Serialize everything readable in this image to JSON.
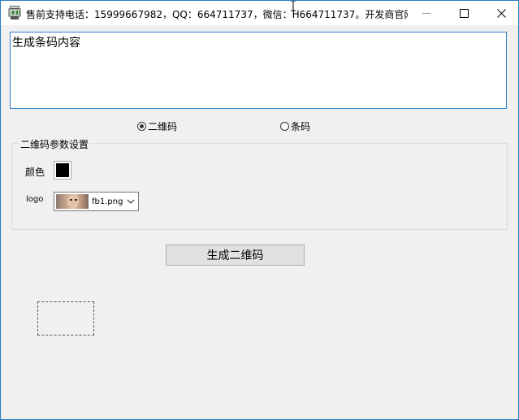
{
  "window": {
    "title": "售前支持电话：15999667982，QQ：664711737，微信：H664711737。开发商官网...",
    "icon": "app-barcode-icon",
    "controls": {
      "minimize": "minimize-icon",
      "maximize": "maximize-icon",
      "close": "close-icon"
    }
  },
  "content_input": {
    "value": "生成条码内容"
  },
  "mode": {
    "options": [
      {
        "label": "二维码",
        "checked": true
      },
      {
        "label": "条码",
        "checked": false
      }
    ]
  },
  "qr_settings": {
    "group_title": "二维码参数设置",
    "color_label": "颜色",
    "color_value": "#000000",
    "logo_label": "logo",
    "logo_file": "fb1.png"
  },
  "generate_button": {
    "label": "生成二维码"
  },
  "colors": {
    "accent_border": "#2f7fcb",
    "window_bg": "#f0f0f0",
    "button_bg": "#e1e1e1"
  }
}
